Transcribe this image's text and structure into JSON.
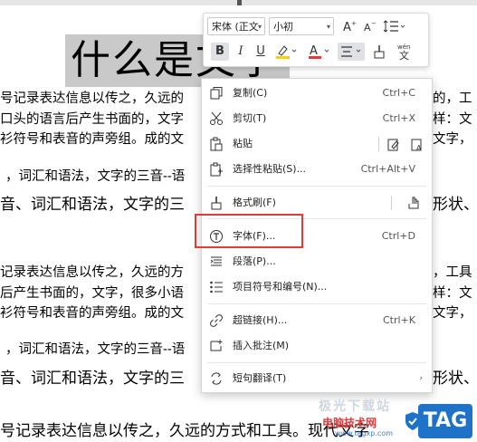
{
  "document": {
    "title": "什么是文字",
    "lines": [
      {
        "text": "号记录表达信息以传之，久远的",
        "right": "的，工"
      },
      {
        "text": "口头的语言后产生书面的，文字",
        "right": "样：文"
      },
      {
        "text": "衫符号和表音的声旁组。成的文",
        "right": "文字，"
      },
      {
        "text": "，词汇和语法，文字的三音--语",
        "right": ""
      },
      {
        "text": "音、词汇和语法，文字的三",
        "right": "形状、义"
      },
      {
        "text": "记录表达信息以传之，久远的方",
        "right": "，工具"
      },
      {
        "text": "后产生书面的，文字，很多小语",
        "right": "样：文"
      },
      {
        "text": "衫符号和表音的声旁组。成的文",
        "right": "文字，"
      },
      {
        "text": "，词汇和语法，文字的三音--语",
        "right": ""
      },
      {
        "text": "音、词汇和语法，文字的三",
        "right": "形状、义"
      },
      {
        "text": "号记录表达信息以传之，久远的方式和工具。现代文字",
        "right": ""
      }
    ]
  },
  "mini_toolbar": {
    "font_name": "宋体 (正文",
    "font_size": "小初",
    "bold": "B",
    "italic": "I",
    "underline": "U",
    "font_color_label": "A",
    "pinyin_label": "wén",
    "highlight_color": "#f5d200",
    "font_color": "#e53935"
  },
  "context_menu": {
    "items": [
      {
        "label": "复制(C)",
        "shortcut": "Ctrl+C",
        "icon": "copy-icon"
      },
      {
        "label": "剪切(T)",
        "shortcut": "Ctrl+X",
        "icon": "cut-icon"
      },
      {
        "label": "粘贴",
        "shortcut": "",
        "icon": "paste-icon"
      },
      {
        "label": "选择性粘贴(S)...",
        "shortcut": "Ctrl+Alt+V",
        "icon": "paste-special-icon"
      },
      {
        "label": "格式刷(F)",
        "shortcut": "",
        "icon": "format-painter-icon"
      },
      {
        "label": "字体(F)...",
        "shortcut": "Ctrl+D",
        "icon": "font-icon"
      },
      {
        "label": "段落(P)...",
        "shortcut": "",
        "icon": "paragraph-icon"
      },
      {
        "label": "项目符号和编号(N)...",
        "shortcut": "",
        "icon": "bullets-icon"
      },
      {
        "label": "超链接(H)...",
        "shortcut": "Ctrl+K",
        "icon": "hyperlink-icon"
      },
      {
        "label": "插入批注(M)",
        "shortcut": "",
        "icon": "comment-icon"
      },
      {
        "label": "短句翻译(T)",
        "shortcut": "",
        "icon": "translate-icon"
      }
    ],
    "highlight_color": "#e53935"
  },
  "watermark": {
    "site_name": "电脑技术网",
    "url": "www.tagxp.com",
    "badge": "TAG",
    "top_text": "极光下载站"
  }
}
